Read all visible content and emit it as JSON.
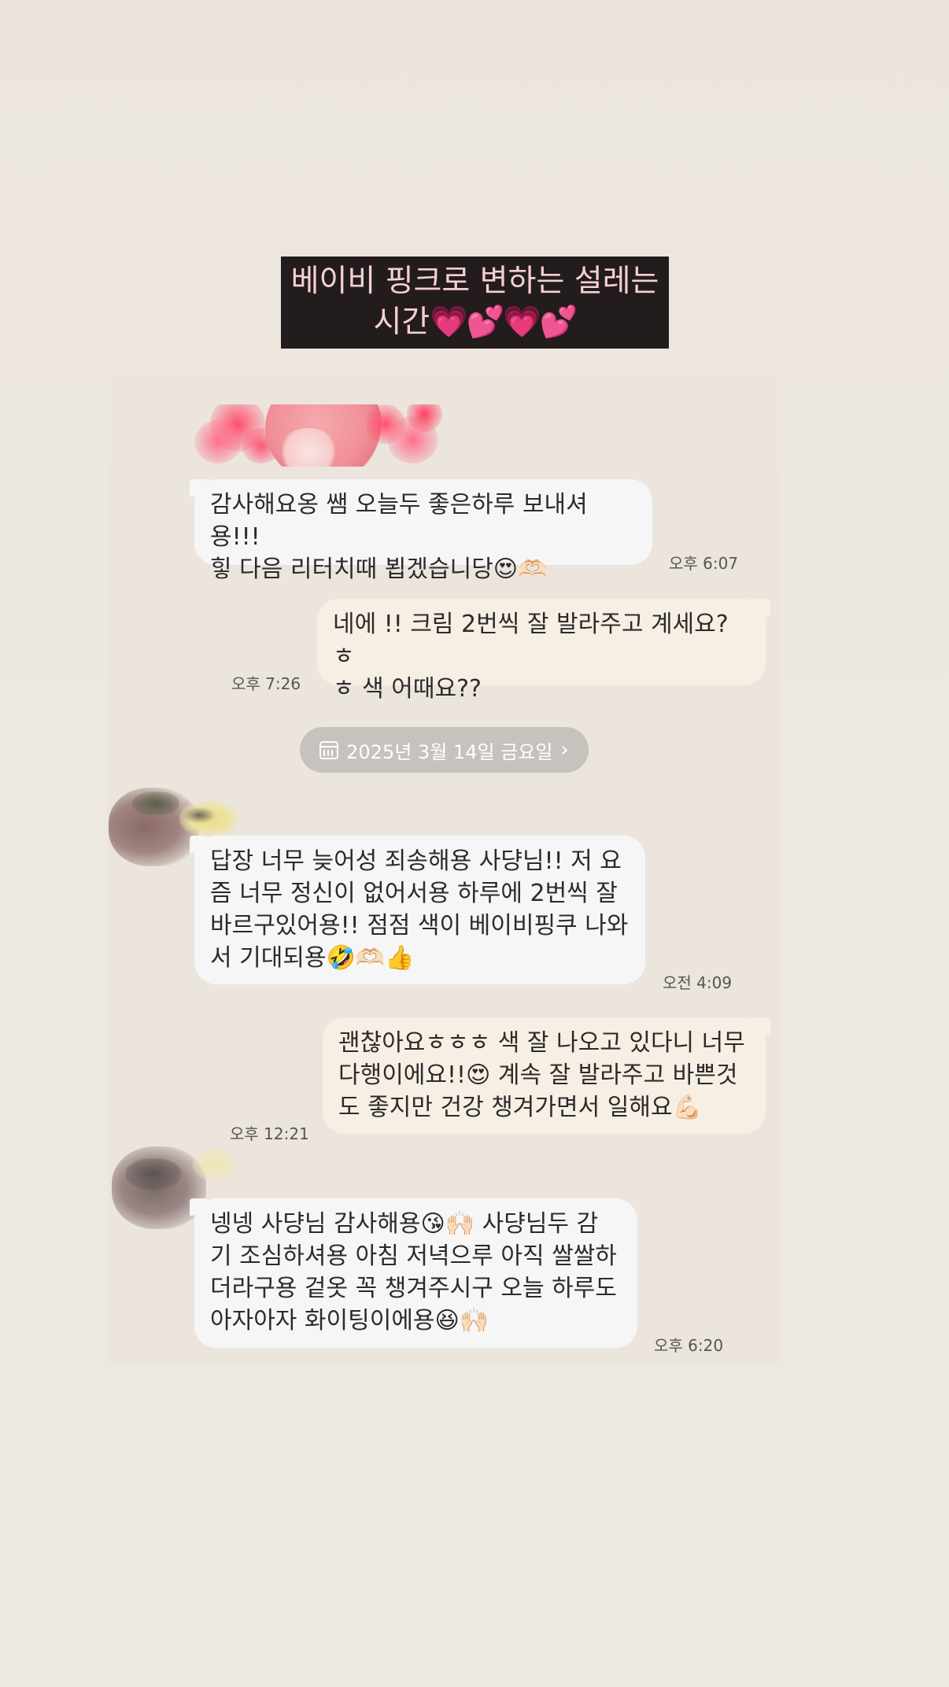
{
  "title_banner": {
    "line1": "베이비 핑크로 변하는 설레는",
    "line2": "시간",
    "hearts": "💗💕💗💕"
  },
  "messages": [
    {
      "sender": "other",
      "lines": [
        "감사해요옹 쌤 오늘두 좋은하루 보내셔용!!!",
        "힣 다음 리터치때 뵙겠습니당😍🫶🏻"
      ],
      "time": "오후 6:07"
    },
    {
      "sender": "me",
      "lines": [
        "네에 !! 크림 2번씩 잘 발라주고 계세요?ㅎ",
        "ㅎ 색 어때요??"
      ],
      "time": "오후 7:26"
    },
    {
      "sender": "other",
      "lines": [
        "답장 너무 늦어성 죄송해용 사댱님!! 저 요",
        "즘 너무 정신이 없어서용 하루에 2번씩 잘",
        "바르구있어용!! 점점 색이 베이비핑쿠 나와",
        "서 기대되용🤣🫶🏻👍"
      ],
      "time": "오전 4:09"
    },
    {
      "sender": "me",
      "lines": [
        "괜찮아요ㅎㅎㅎ 색 잘 나오고 있다니 너무",
        "다행이에요!!😍 계속 잘 발라주고 바쁜것",
        "도 좋지만 건강 챙겨가면서 일해요💪🏻"
      ],
      "time": "오후 12:21"
    },
    {
      "sender": "other",
      "lines": [
        "넹넹 사댱님 감사해용😘🙌🏻 사댱님두 감",
        "기 조심하셔용 아침 저녁으루 아직 쌀쌀하",
        "더라구용 겉옷 꼭 챙겨주시구 오늘 하루도",
        "아자아자 화이팅이에용😆🙌🏻"
      ],
      "time": "오후 6:20"
    }
  ],
  "date_divider": {
    "label": "2025년 3월 14일 금요일",
    "icon": "calendar-icon",
    "chevron": "›"
  },
  "colors": {
    "background": "#ebe5de",
    "banner_bg": "#231c1d",
    "banner_text": "#f5cfd5",
    "incoming_bubble": "#f6f6f7",
    "outgoing_bubble": "#f7efe4",
    "date_pill": "#c6c3be"
  }
}
